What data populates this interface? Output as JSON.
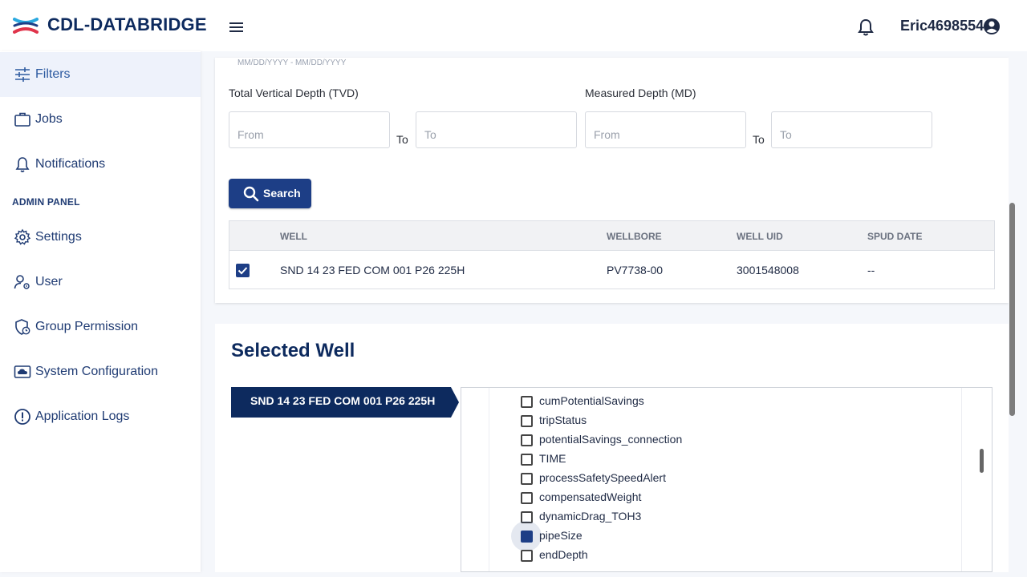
{
  "header": {
    "brand": "CDL-DATABRIDGE",
    "username": "Eric4698554",
    "icons": [
      "logo-icon",
      "hamburger-menu-icon",
      "bell-icon",
      "account-circle-icon"
    ]
  },
  "sidebar": {
    "items": [
      {
        "label": "Filters",
        "icon": "tune-icon"
      },
      {
        "label": "Jobs",
        "icon": "briefcase-icon"
      },
      {
        "label": "Notifications",
        "icon": "bell-icon"
      },
      {
        "label": "Settings",
        "icon": "gear-icon"
      },
      {
        "label": "User",
        "icon": "user-settings-icon"
      },
      {
        "label": "Group Permission",
        "icon": "shield-clock-icon"
      },
      {
        "label": "System Configuration",
        "icon": "cloud-monitor-icon"
      },
      {
        "label": "Application Logs",
        "icon": "alert-circle-icon"
      }
    ],
    "admin_heading": "ADMIN PANEL"
  },
  "filters": {
    "date_hint": "MM/DD/YYYY - MM/DD/YYYY",
    "tvd_label": "Total Vertical Depth (TVD)",
    "md_label": "Measured Depth (MD)",
    "from_placeholder": "From",
    "to_placeholder": "To",
    "to_label": "To",
    "search_label": "Search"
  },
  "table": {
    "columns": [
      "WELL",
      "WELLBORE",
      "WELL UID",
      "SPUD DATE"
    ],
    "rows": [
      {
        "checked": true,
        "well": "SND 14 23 FED COM 001 P26 225H",
        "wellbore": "PV7738-00",
        "well_uid": "3001548008",
        "spud_date": "--"
      }
    ]
  },
  "selected": {
    "title": "Selected Well",
    "well_tab": "SND 14 23 FED COM 001 P26 225H",
    "params": [
      {
        "label": "cumPotentialSavings",
        "checked": false
      },
      {
        "label": "tripStatus",
        "checked": false
      },
      {
        "label": "potentialSavings_connection",
        "checked": false
      },
      {
        "label": "TIME",
        "checked": false
      },
      {
        "label": "processSafetySpeedAlert",
        "checked": false
      },
      {
        "label": "compensatedWeight",
        "checked": false
      },
      {
        "label": "dynamicDrag_TOH3",
        "checked": false
      },
      {
        "label": "pipeSize",
        "checked": true
      },
      {
        "label": "endDepth",
        "checked": false
      }
    ]
  },
  "colors": {
    "primary": "#1d3e86",
    "brand_text": "#0d2a5e",
    "logo_red": "#e0344b",
    "logo_blue": "#2aa9e0"
  }
}
